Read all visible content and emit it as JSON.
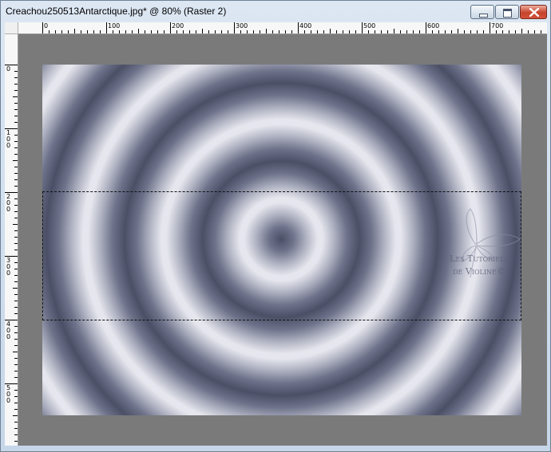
{
  "window": {
    "title": "Creachou250513Antarctique.jpg* @  80% (Raster 2)"
  },
  "rulers": {
    "horizontal_labels": [
      "0",
      "100",
      "200",
      "300",
      "400",
      "500",
      "600",
      "700"
    ],
    "vertical_labels": [
      "0",
      "100",
      "200",
      "300",
      "400",
      "500"
    ]
  },
  "canvas": {
    "background_color": "#7a7a7a",
    "gradient_dark": "#4b4f66",
    "gradient_light": "#e6e7ee",
    "pattern": "concentric-rings"
  },
  "watermark": {
    "line1": "Les Tutoriels",
    "line2": "de Violine©",
    "icon": "butterfly-icon"
  }
}
